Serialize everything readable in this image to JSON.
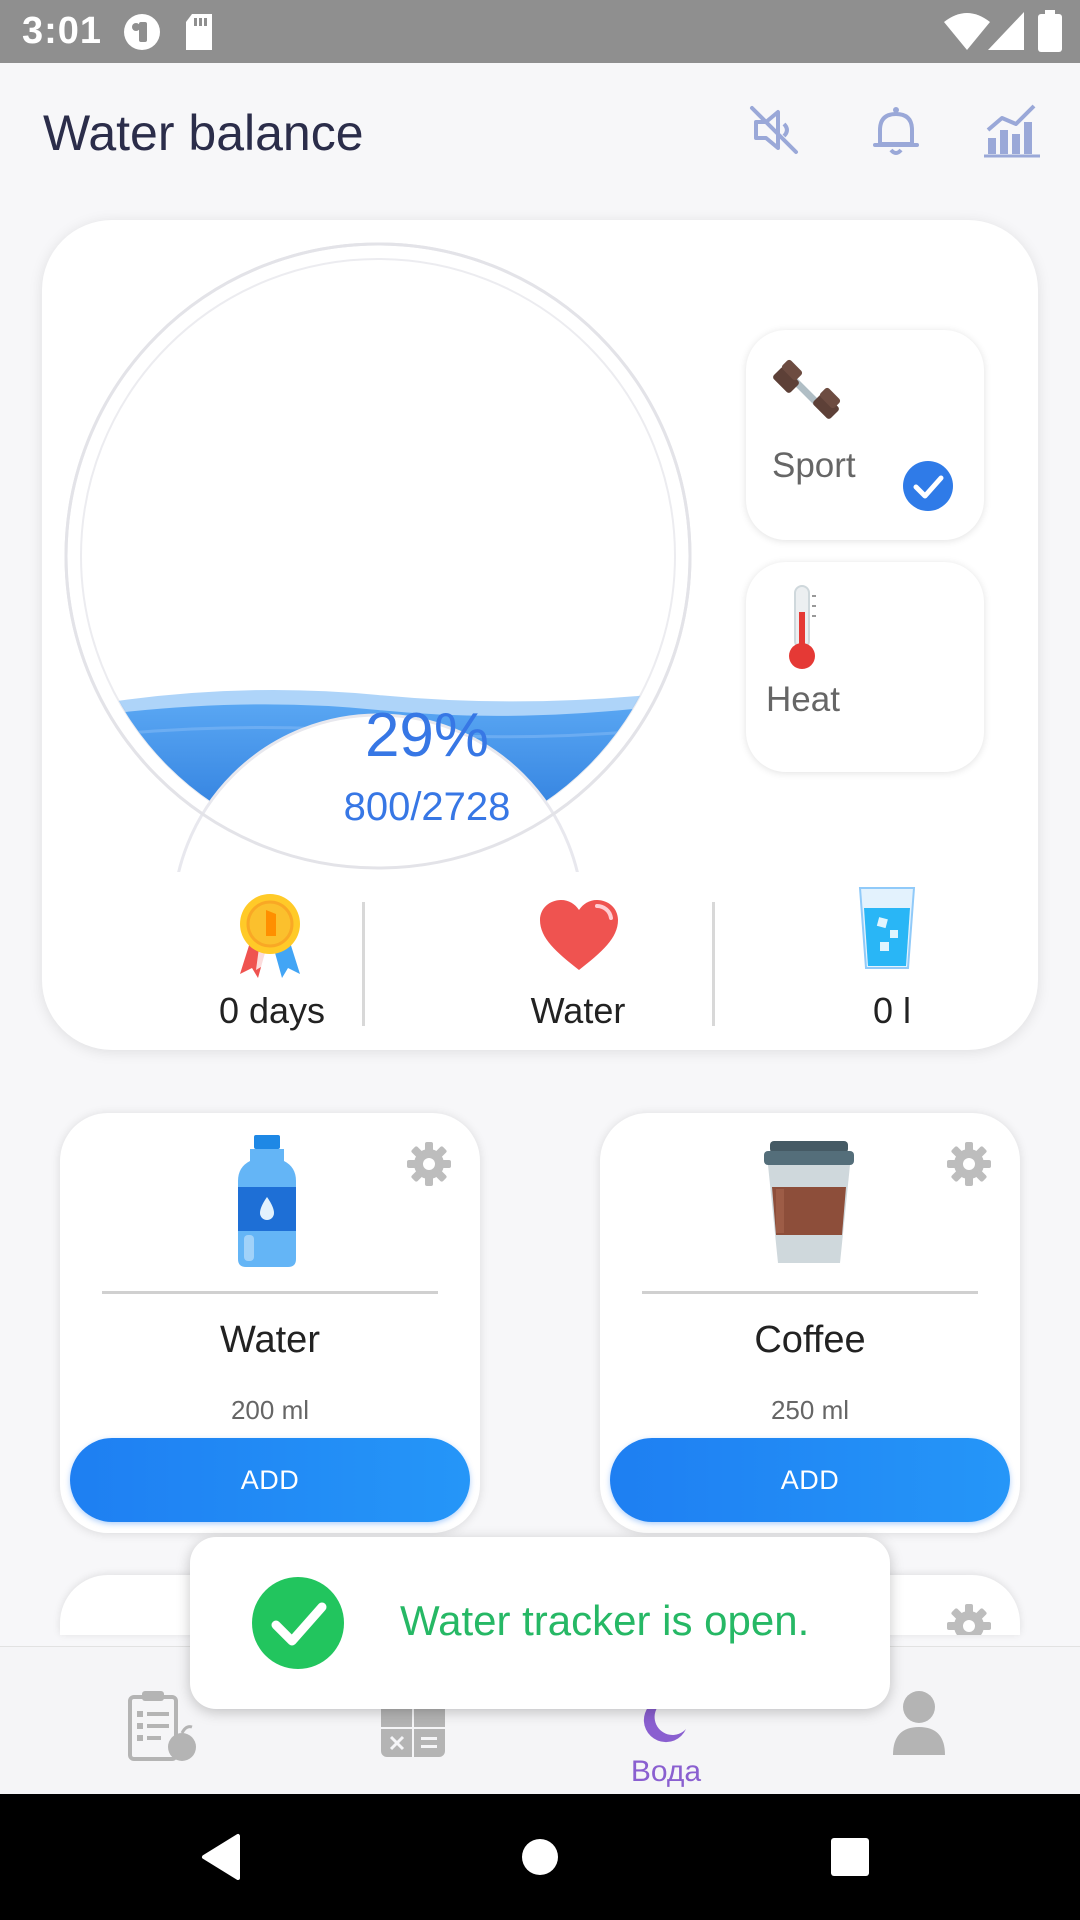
{
  "status_bar": {
    "time": "3:01",
    "icons": [
      "media-icon",
      "sd-card-icon",
      "wifi-icon",
      "signal-icon",
      "battery-icon"
    ]
  },
  "header": {
    "title": "Water balance",
    "actions": [
      "sound-muted-icon",
      "bell-icon",
      "statistics-icon"
    ]
  },
  "gauge": {
    "percent_label": "29%",
    "amount_label": "800/2728",
    "fill_fraction": 0.29,
    "water_color": "#3a8ff0"
  },
  "factors": {
    "sport": {
      "label": "Sport",
      "checked": true,
      "icon": "dumbbell-icon"
    },
    "heat": {
      "label": "Heat",
      "checked": false,
      "icon": "thermometer-icon"
    }
  },
  "stats": [
    {
      "label": "0 days",
      "icon": "medal-icon"
    },
    {
      "label": "Water",
      "icon": "heart-icon"
    },
    {
      "label": "0 l",
      "icon": "glass-icon"
    }
  ],
  "drinks": [
    {
      "name": "Water",
      "volume": "200 ml",
      "button": "ADD",
      "icon": "water-bottle-icon"
    },
    {
      "name": "Coffee",
      "volume": "250 ml",
      "button": "ADD",
      "icon": "coffee-cup-icon"
    }
  ],
  "toast": {
    "message": "Water tracker is open.",
    "icon": "check-circle-icon"
  },
  "bottom_nav": {
    "items": [
      {
        "name": "diary",
        "label": "",
        "icon": "clipboard-apple-icon"
      },
      {
        "name": "calculator",
        "label": "",
        "icon": "calculator-icon"
      },
      {
        "name": "water",
        "label": "Вода",
        "icon": "moon-icon",
        "active": true
      },
      {
        "name": "profile",
        "label": "",
        "icon": "person-icon"
      }
    ]
  },
  "colors": {
    "accent": "#3777e5",
    "button": "#1e88f5",
    "nav_active": "#8a5fd0",
    "toast_green": "#26b865"
  }
}
